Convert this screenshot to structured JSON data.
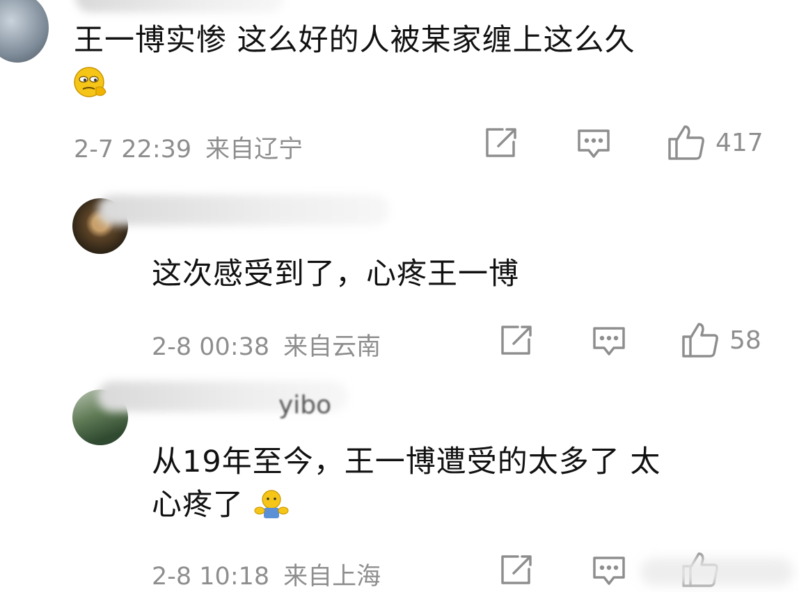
{
  "comments": [
    {
      "username": "",
      "text": "王一博实惨 这么好的人被某家缠上这么久",
      "emoji": "thinking-face-emoji",
      "time": "2-7 22:39",
      "region": "来自辽宁",
      "likes": "417"
    },
    {
      "username": "",
      "text": "这次感受到了，心疼王一博",
      "time": "2-8 00:38",
      "region": "来自云南",
      "likes": "58"
    },
    {
      "username": "",
      "username_visible_part": "yibo",
      "text_line1": "从19年至今，王一博遭受的太多了 太",
      "text_line2": "心疼了",
      "emoji": "hug-emoji",
      "time": "2-8 10:18",
      "region": "来自上海",
      "likes": ""
    }
  ],
  "icons": {
    "share": "share-icon",
    "comment": "comment-icon",
    "like": "thumbs-up-icon"
  },
  "colors": {
    "meta_gray": "#8e8e8e",
    "text": "#111111",
    "emoji_yellow": "#f5c518"
  }
}
